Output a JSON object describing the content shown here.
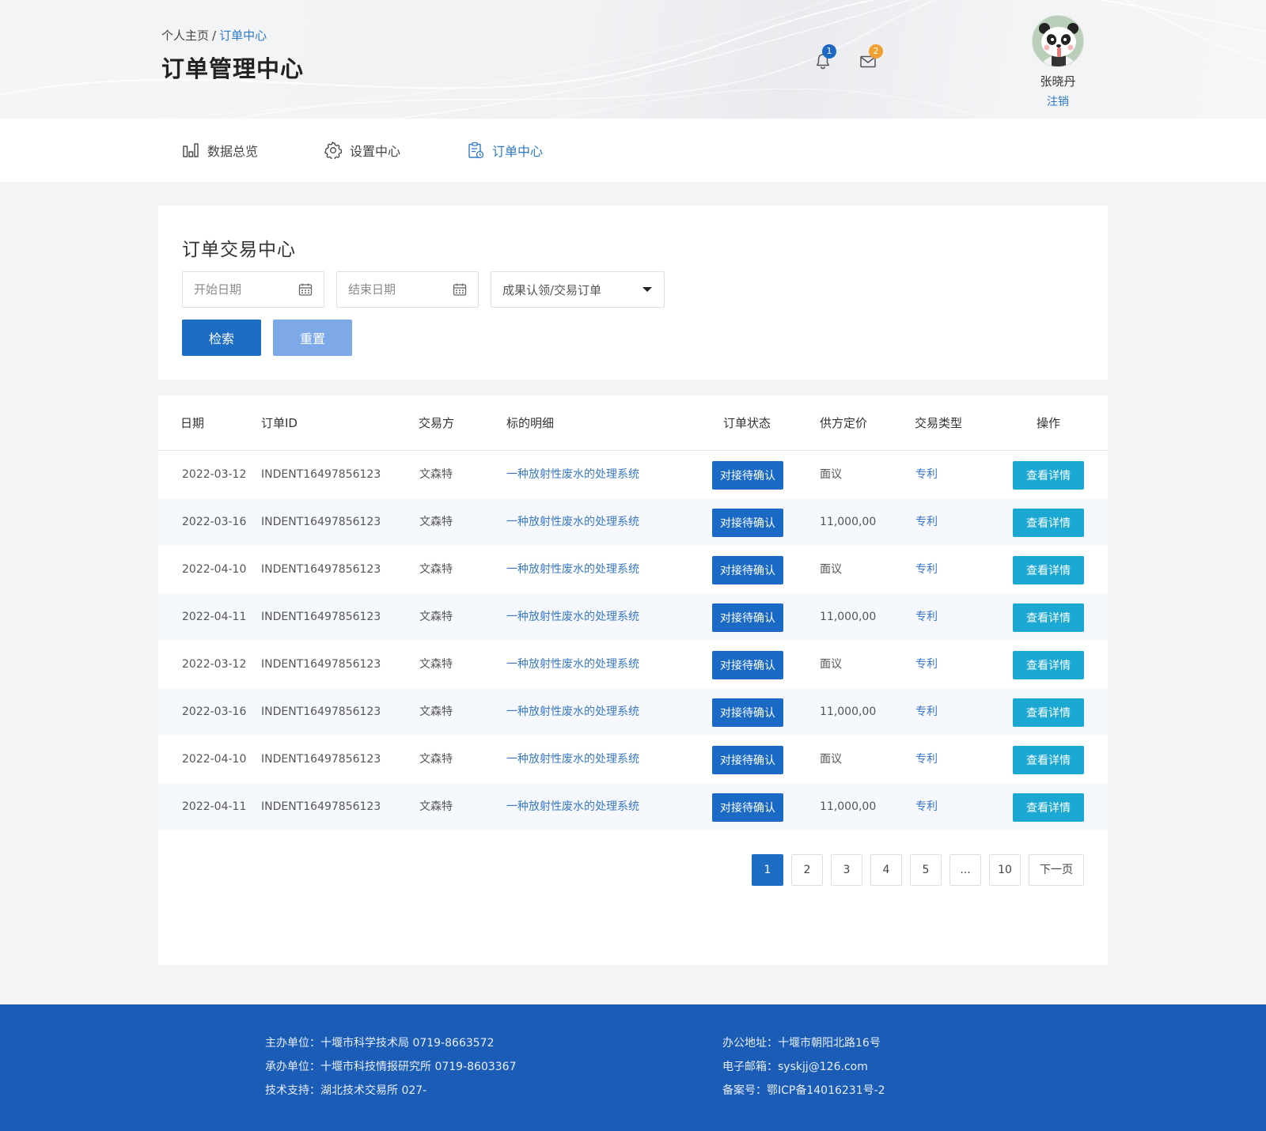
{
  "header": {
    "breadcrumb_home": "个人主页",
    "breadcrumb_sep": "/",
    "breadcrumb_current": "订单中心",
    "title": "订单管理中心",
    "notifications": {
      "icon": "bell-icon",
      "count": "1"
    },
    "messages": {
      "icon": "mail-icon",
      "count": "2"
    },
    "user": {
      "name": "张晓丹",
      "logout": "注销",
      "avatar_icon": "panda-avatar-icon"
    }
  },
  "nav": {
    "items": [
      {
        "label": "数据总览",
        "icon": "bar-chart-icon"
      },
      {
        "label": "设置中心",
        "icon": "gear-icon"
      },
      {
        "label": "订单中心",
        "icon": "order-clipboard-icon"
      }
    ],
    "active_index": 2
  },
  "search": {
    "title": "订单交易中心",
    "start_date_placeholder": "开始日期",
    "end_date_placeholder": "结束日期",
    "type_select_value": "成果认领/交易订单",
    "search_label": "检索",
    "reset_label": "重置"
  },
  "table": {
    "headers": [
      "日期",
      "订单ID",
      "交易方",
      "标的明细",
      "订单状态",
      "供方定价",
      "交易类型",
      "操作"
    ],
    "rows": [
      {
        "date": "2022-03-12",
        "id": "INDENT16497856123",
        "party": "文森特",
        "item": "一种放射性废水的处理系统",
        "status": "对接待确认",
        "price": "面议",
        "type": "专利",
        "action": "查看详情"
      },
      {
        "date": "2022-03-16",
        "id": "INDENT16497856123",
        "party": "文森特",
        "item": "一种放射性废水的处理系统",
        "status": "对接待确认",
        "price": "11,000,00",
        "type": "专利",
        "action": "查看详情"
      },
      {
        "date": "2022-04-10",
        "id": "INDENT16497856123",
        "party": "文森特",
        "item": "一种放射性废水的处理系统",
        "status": "对接待确认",
        "price": "面议",
        "type": "专利",
        "action": "查看详情"
      },
      {
        "date": "2022-04-11",
        "id": "INDENT16497856123",
        "party": "文森特",
        "item": "一种放射性废水的处理系统",
        "status": "对接待确认",
        "price": "11,000,00",
        "type": "专利",
        "action": "查看详情"
      },
      {
        "date": "2022-03-12",
        "id": "INDENT16497856123",
        "party": "文森特",
        "item": "一种放射性废水的处理系统",
        "status": "对接待确认",
        "price": "面议",
        "type": "专利",
        "action": "查看详情"
      },
      {
        "date": "2022-03-16",
        "id": "INDENT16497856123",
        "party": "文森特",
        "item": "一种放射性废水的处理系统",
        "status": "对接待确认",
        "price": "11,000,00",
        "type": "专利",
        "action": "查看详情"
      },
      {
        "date": "2022-04-10",
        "id": "INDENT16497856123",
        "party": "文森特",
        "item": "一种放射性废水的处理系统",
        "status": "对接待确认",
        "price": "面议",
        "type": "专利",
        "action": "查看详情"
      },
      {
        "date": "2022-04-11",
        "id": "INDENT16497856123",
        "party": "文森特",
        "item": "一种放射性废水的处理系统",
        "status": "对接待确认",
        "price": "11,000,00",
        "type": "专利",
        "action": "查看详情"
      }
    ]
  },
  "pagination": {
    "pages": [
      "1",
      "2",
      "3",
      "4",
      "5",
      "...",
      "10"
    ],
    "current": "1",
    "next_label": "下一页"
  },
  "footer": {
    "host": "主办单位：十堰市科学技术局   0719-8663572",
    "organizer": "承办单位：十堰市科技情报研究所   0719-8603367",
    "support": "技术支持：湖北技术交易所   027-",
    "address": "办公地址：十堰市朝阳北路16号",
    "email": "电子邮箱：syskjj@126.com",
    "icp": "备案号：鄂ICP备14016231号-2"
  },
  "colors": {
    "primary": "#1e6dc4",
    "link": "#2f79c8",
    "detail_button": "#1ba8d3",
    "reset_button": "#7da9e8",
    "footer_bg": "#1a5cb6",
    "badge_orange": "#f0a030"
  }
}
